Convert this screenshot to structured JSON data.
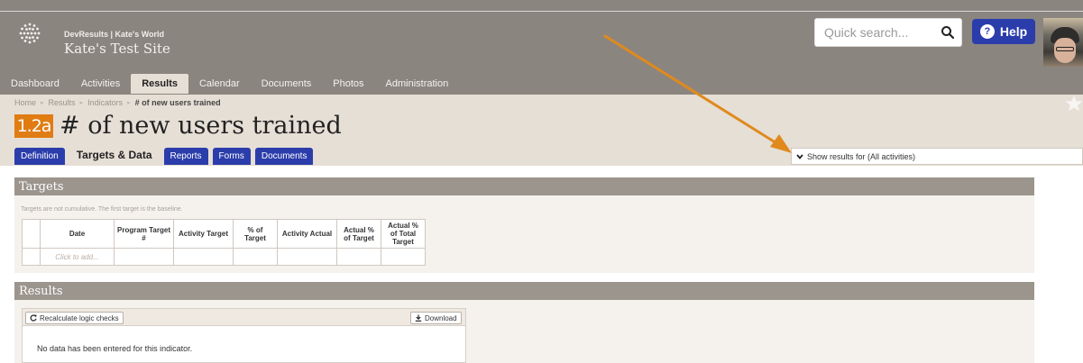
{
  "header": {
    "org": "DevResults | Kate's World",
    "site_name": "Kate's Test Site",
    "search_placeholder": "Quick search...",
    "help_label": "Help"
  },
  "nav": [
    "Dashboard",
    "Activities",
    "Results",
    "Calendar",
    "Documents",
    "Photos",
    "Administration"
  ],
  "nav_active": "Results",
  "breadcrumb": [
    "Home",
    "Results",
    "Indicators",
    "# of new users trained"
  ],
  "indicator": {
    "code": "1.2a",
    "title": "# of new users trained"
  },
  "tabs": [
    "Definition",
    "Targets & Data",
    "Reports",
    "Forms",
    "Documents"
  ],
  "tab_active": "Targets & Data",
  "results_filter": "Show results for (All activities)",
  "targets": {
    "heading": "Targets",
    "note": "Targets are not cumulative. The first target is the baseline.",
    "columns": [
      "",
      "Date",
      "Program Target #",
      "Activity Target",
      "% of Target",
      "Activity Actual",
      "Actual % of Target",
      "Actual % of Total Target"
    ],
    "add_placeholder": "Click to add..."
  },
  "results": {
    "heading": "Results",
    "recalc_label": "Recalculate logic checks",
    "download_label": "Download",
    "empty_message": "No data has been entered for this indicator."
  },
  "colors": {
    "accent": "#2b3dab",
    "badge": "#e07c12",
    "annotation_arrow": "#e08a1e"
  }
}
